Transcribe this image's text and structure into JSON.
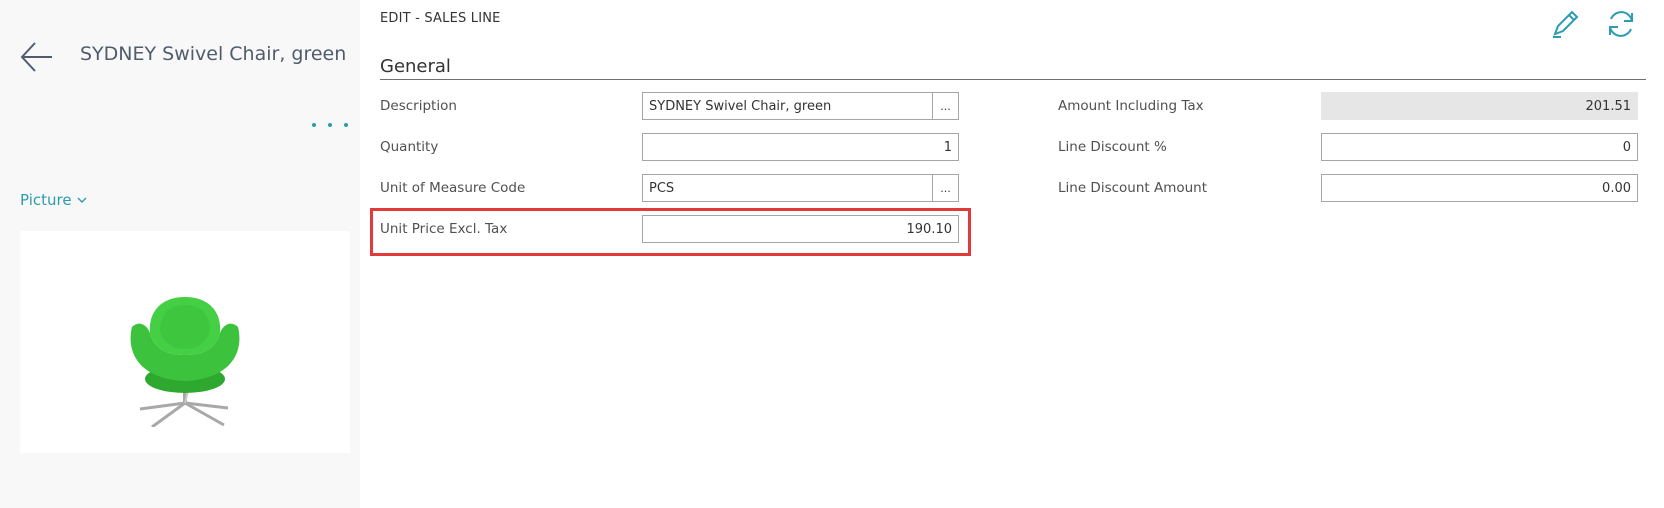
{
  "header": {
    "record_title": "SYDNEY Swivel Chair, green",
    "caption": "EDIT - SALES LINE"
  },
  "factbox": {
    "picture_label": "Picture"
  },
  "section": {
    "title": "General"
  },
  "fields_left": {
    "description": {
      "label": "Description",
      "value": "SYDNEY Swivel Chair, green",
      "lookup": "..."
    },
    "quantity": {
      "label": "Quantity",
      "value": "1"
    },
    "unit_of_measure": {
      "label": "Unit of Measure Code",
      "value": "PCS",
      "lookup": "..."
    },
    "unit_price": {
      "label": "Unit Price Excl. Tax",
      "value": "190.10"
    }
  },
  "fields_right": {
    "amount_incl_tax": {
      "label": "Amount Including Tax",
      "value": "201.51"
    },
    "line_discount_pct": {
      "label": "Line Discount %",
      "value": "0"
    },
    "line_discount_amount": {
      "label": "Line Discount Amount",
      "value": "0.00"
    }
  },
  "icons": {
    "back": "back-arrow-icon",
    "more": "more-options-icon",
    "chevron": "chevron-down-icon",
    "edit": "pencil-icon",
    "refresh": "refresh-icon"
  },
  "colors": {
    "accent": "#2d9bb0",
    "title": "#505c6d",
    "highlight": "#e03a3a",
    "chair": "#3dc23d"
  }
}
